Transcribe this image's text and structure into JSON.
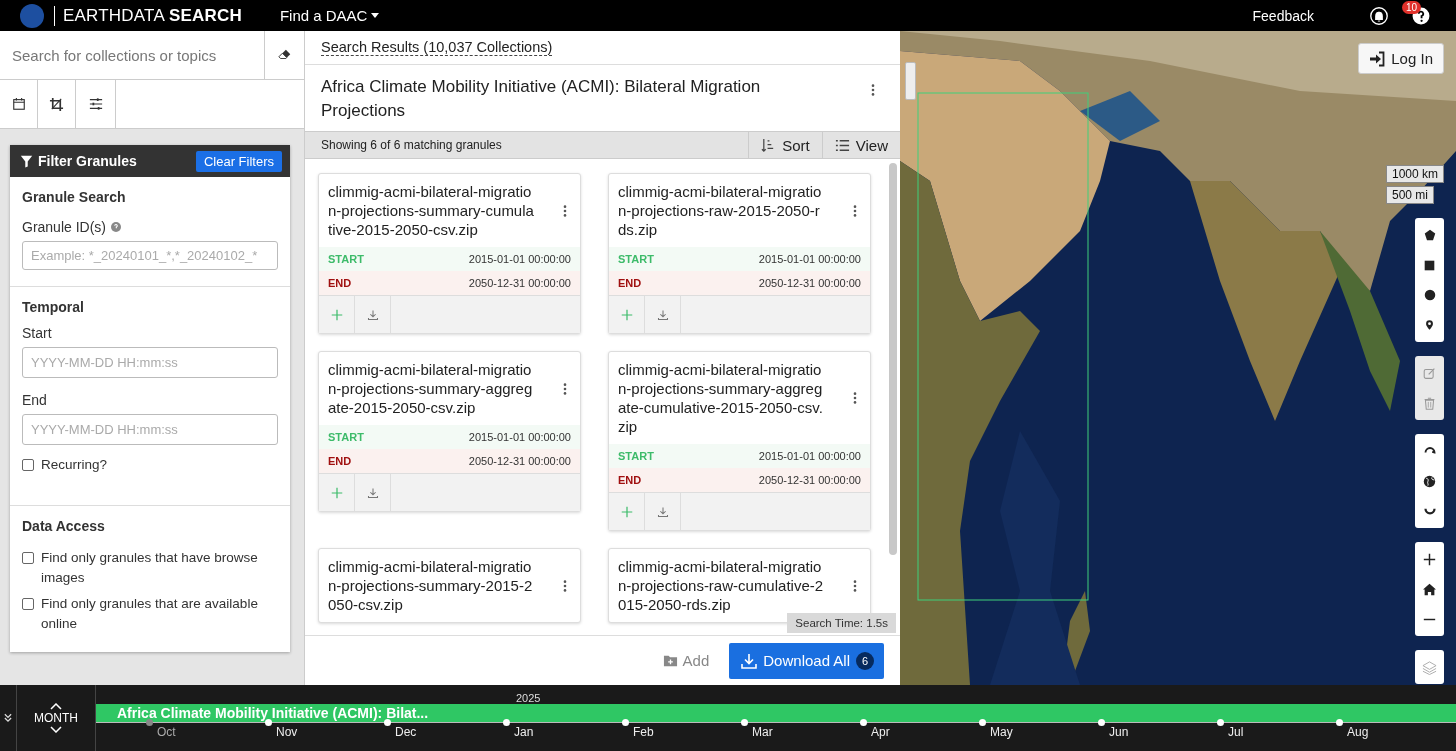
{
  "header": {
    "title": "EARTHDATA **SEARCH**",
    "daac_menu": "Find a DAAC",
    "feedback": "Feedback",
    "notification_count": "10"
  },
  "sidebar": {
    "search": {
      "placeholder": "Search for collections or topics"
    },
    "filter": {
      "title": "Filter Granules",
      "clear": "Clear Filters",
      "granule_search": {
        "heading": "Granule Search",
        "label": "Granule ID(s)",
        "placeholder": "Example: *_20240101_*,*_20240102_*"
      },
      "temporal": {
        "heading": "Temporal",
        "start_label": "Start",
        "start_placeholder": "YYYY-MM-DD HH:mm:ss",
        "end_label": "End",
        "end_placeholder": "YYYY-MM-DD HH:mm:ss",
        "recurring": {
          "label": "Recurring?",
          "checked": false
        }
      },
      "data_access": {
        "heading": "Data Access",
        "options": [
          {
            "label": "Find only granules that have browse images",
            "checked": false
          },
          {
            "label": "Find only granules that are available online",
            "checked": false
          }
        ]
      }
    }
  },
  "results": {
    "heading": "Search Results (10,037 Collections)",
    "collection_title": "Africa Climate Mobility Initiative (ACMI): Bilateral Migration Projections",
    "count_text": "Showing 6 of 6 matching granules",
    "sort": "Sort",
    "view": "View",
    "granules": [
      {
        "name": "climmig-acmi-bilateral-migration-projections-summary-cumulative-2015-2050-csv.zip",
        "start_label": "START",
        "start": "2015-01-01 00:00:00",
        "end_label": "END",
        "end": "2050-12-31 00:00:00"
      },
      {
        "name": "climmig-acmi-bilateral-migration-projections-raw-2015-2050-rds.zip",
        "start_label": "START",
        "start": "2015-01-01 00:00:00",
        "end_label": "END",
        "end": "2050-12-31 00:00:00"
      },
      {
        "name": "climmig-acmi-bilateral-migration-projections-summary-aggregate-2015-2050-csv.zip",
        "start_label": "START",
        "start": "2015-01-01 00:00:00",
        "end_label": "END",
        "end": "2050-12-31 00:00:00"
      },
      {
        "name": "climmig-acmi-bilateral-migration-projections-summary-aggregate-cumulative-2015-2050-csv.zip",
        "start_label": "START",
        "start": "2015-01-01 00:00:00",
        "end_label": "END",
        "end": "2050-12-31 00:00:00"
      },
      {
        "name": "climmig-acmi-bilateral-migration-projections-summary-2015-2050-csv.zip"
      },
      {
        "name": "climmig-acmi-bilateral-migration-projections-raw-cumulative-2015-2050-rds.zip"
      }
    ],
    "search_time": "Search Time: 1.5s",
    "add": "Add",
    "download": "Download All",
    "download_count": "6"
  },
  "map": {
    "login": "Log In",
    "scale": [
      "1000 km",
      "500 mi"
    ]
  },
  "timeline": {
    "zoom": "MONTH",
    "year": "2025",
    "bar_label": "Africa Climate Mobility Initiative (ACMI): Bilat...",
    "months": [
      "Oct",
      "Nov",
      "Dec",
      "Jan",
      "Feb",
      "Mar",
      "Apr",
      "May",
      "Jun",
      "Jul",
      "Aug"
    ]
  }
}
